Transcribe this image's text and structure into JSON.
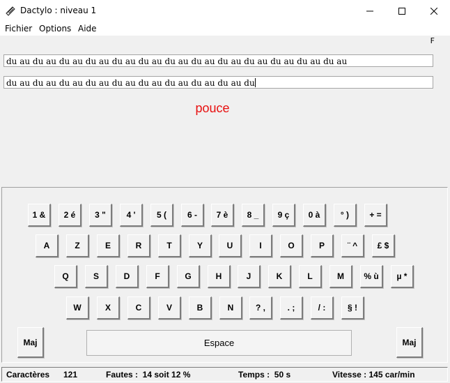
{
  "window": {
    "title": "Dactylo : niveau 1"
  },
  "menu": [
    "Fichier",
    "Options",
    "Aide"
  ],
  "indicator": "F",
  "model_text": "du au du au du au du au du au du au du au du au du au du au du au du au du au",
  "typed_text": "du au du au du au du au du au du au du au du au du au du",
  "finger_hint": "pouce",
  "keyboard": {
    "row1": [
      "1 &",
      "2 é",
      "3 \"",
      "4 '",
      "5 (",
      "6 -",
      "7 è",
      "8 _",
      "9 ç",
      "0 à",
      "° )",
      "+ ="
    ],
    "row2": [
      "A",
      "Z",
      "E",
      "R",
      "T",
      "Y",
      "U",
      "I",
      "O",
      "P",
      "¨ ^",
      "£ $"
    ],
    "row3": [
      "Q",
      "S",
      "D",
      "F",
      "G",
      "H",
      "J",
      "K",
      "L",
      "M",
      "% ù",
      "µ *"
    ],
    "row4": [
      "W",
      "X",
      "C",
      "V",
      "B",
      "N",
      "? ,",
      ". ;",
      "/ :",
      "§ !"
    ],
    "maj_left": "Maj",
    "maj_right": "Maj",
    "space": "Espace"
  },
  "status": {
    "chars_label": "Caractères",
    "chars_value": "121",
    "errors": "Fautes :  14 soit 12 %",
    "time": "Temps :  50 s",
    "speed": "Vitesse : 145 car/min"
  },
  "colors": {
    "finger_hint": "#e81010",
    "background": "#f0f0f0"
  },
  "icons": {
    "app": "typewriter-icon",
    "minimize": "minimize-icon",
    "maximize": "maximize-icon",
    "close": "close-icon"
  }
}
